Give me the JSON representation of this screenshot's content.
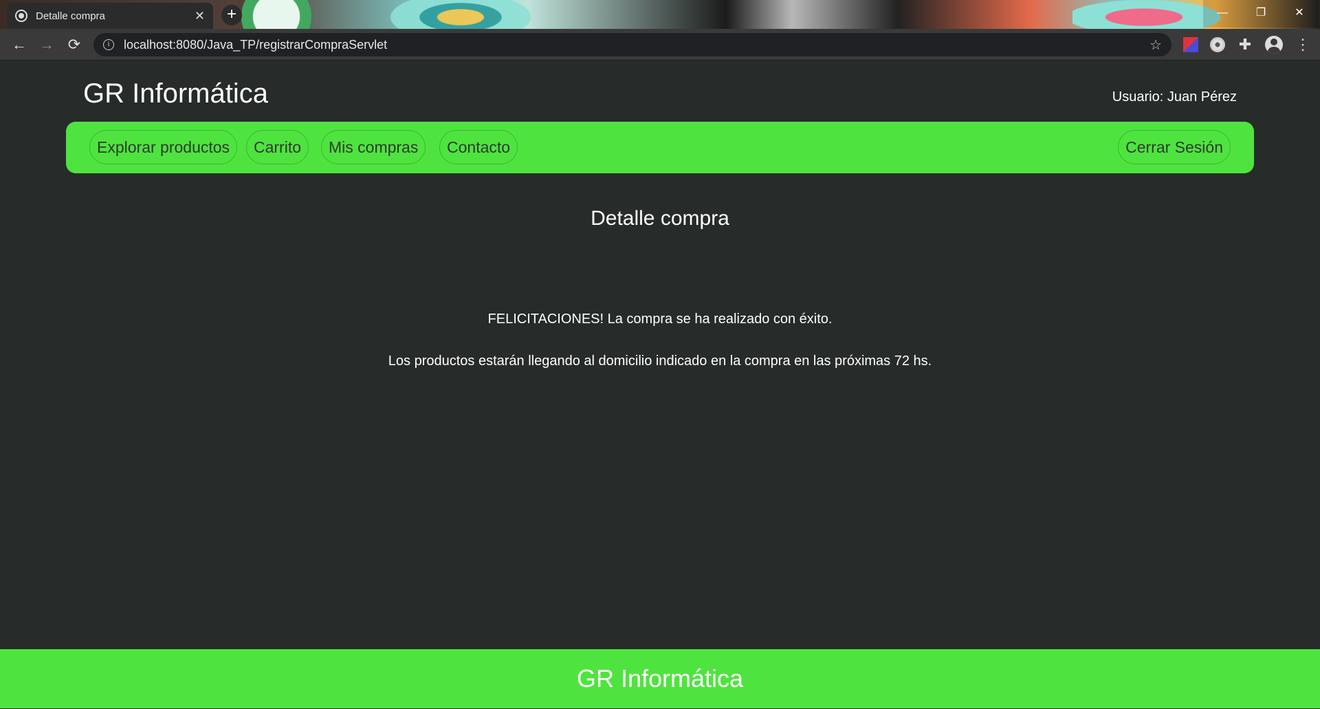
{
  "browser": {
    "tab_title": "Detalle compra",
    "tab_close": "✕",
    "new_tab": "+",
    "window_controls": {
      "minimize": "—",
      "restore": "❐",
      "close": "✕"
    },
    "nav": {
      "back": "←",
      "forward": "→",
      "reload": "⟳"
    },
    "url": "localhost:8080/Java_TP/registrarCompraServlet",
    "info_icon": "i",
    "star": "☆",
    "extensions": [
      "red-blue-extension-icon",
      "record-extension-icon",
      "puzzle-extensions-icon",
      "profile-avatar-icon",
      "more-menu-icon"
    ],
    "puzzle": "✚",
    "more": "⋮"
  },
  "header": {
    "brand": "GR Informática",
    "user": "Usuario: Juan Pérez"
  },
  "nav": {
    "items": [
      {
        "label": "Explorar productos"
      },
      {
        "label": "Carrito"
      },
      {
        "label": "Mis compras"
      },
      {
        "label": "Contacto"
      }
    ],
    "logout": "Cerrar Sesión"
  },
  "main": {
    "title": "Detalle compra",
    "message_1": "FELICITACIONES! La compra se ha realizado con éxito.",
    "message_2": "Los productos estarán llegando al domicilio indicado en la compra en las próximas 72 hs."
  },
  "footer": {
    "brand": "GR Informática"
  },
  "colors": {
    "background": "#272b2a",
    "accent_green": "#4fe340",
    "nav_text": "#2d3a2c"
  }
}
